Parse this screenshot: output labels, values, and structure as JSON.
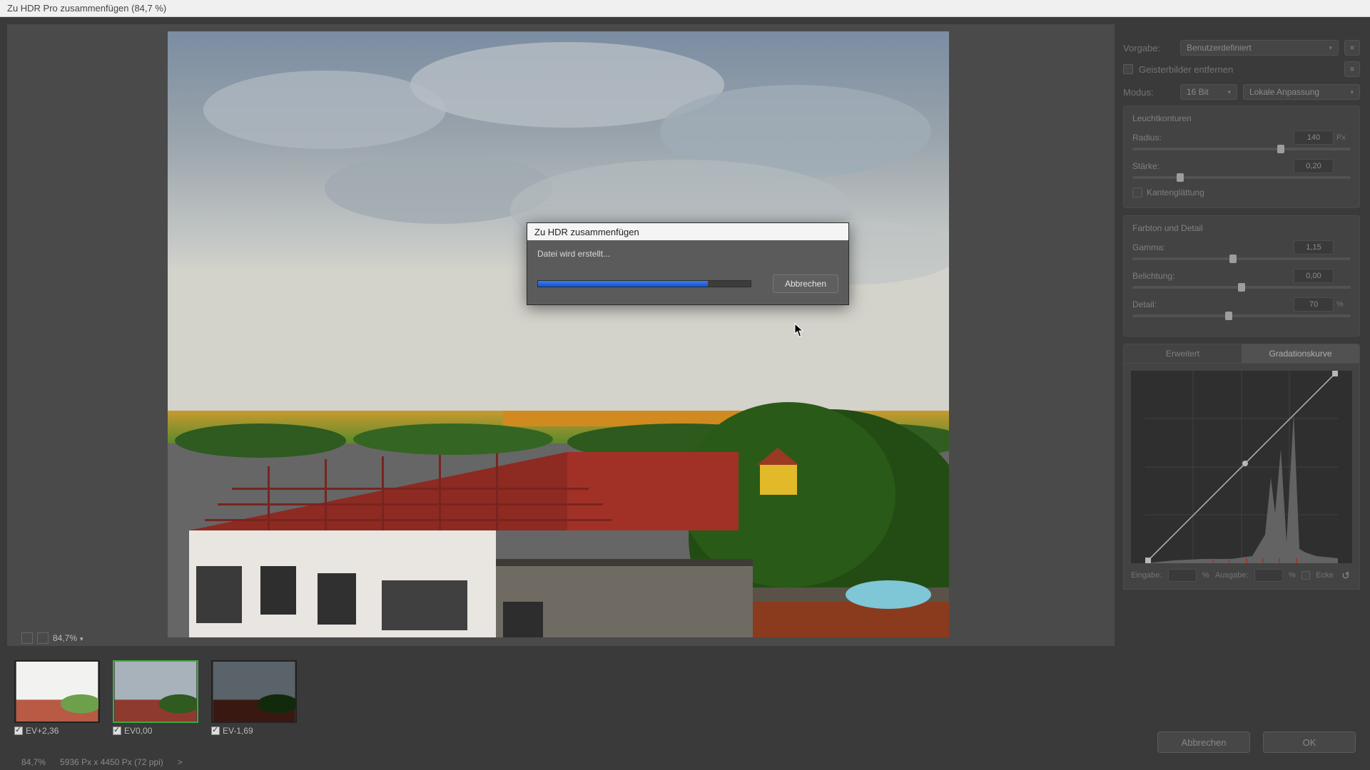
{
  "window": {
    "title": "Zu HDR Pro zusammenfügen (84,7 %)"
  },
  "zoom": {
    "value": "84,7%"
  },
  "thumbnails": [
    {
      "label": "EV+2,36",
      "checked": true,
      "selected": false
    },
    {
      "label": "EV0,00",
      "checked": true,
      "selected": true
    },
    {
      "label": "EV-1,69",
      "checked": true,
      "selected": false
    }
  ],
  "status": {
    "zoom": "84,7%",
    "dims": "5936 Px x 4450 Px (72 ppi)",
    "arrow": ">"
  },
  "side": {
    "preset_label": "Vorgabe:",
    "preset_value": "Benutzerdefiniert",
    "ghost_label": "Geisterbilder entfernen",
    "mode_label": "Modus:",
    "mode_value": "16 Bit",
    "local_value": "Lokale Anpassung",
    "sections": {
      "edgeglow": {
        "title": "Leuchtkonturen",
        "radius_label": "Radius:",
        "radius_value": "140",
        "radius_unit": "Px",
        "strength_label": "Stärke:",
        "strength_value": "0,20",
        "edgesmooth_label": "Kantenglättung"
      },
      "tonedetail": {
        "title": "Farbton und Detail",
        "gamma_label": "Gamma:",
        "gamma_value": "1,15",
        "exposure_label": "Belichtung:",
        "exposure_value": "0,00",
        "detail_label": "Detail:",
        "detail_value": "70",
        "detail_unit": "%"
      }
    },
    "tabs": {
      "advanced": "Erweitert",
      "curve": "Gradationskurve"
    },
    "curve_io": {
      "input_label": "Eingabe:",
      "output_label": "Ausgabe:",
      "pct": "%",
      "corner_label": "Ecke"
    }
  },
  "footer": {
    "cancel": "Abbrechen",
    "ok": "OK"
  },
  "dialog": {
    "title": "Zu HDR zusammenfügen",
    "message": "Datei wird erstellt...",
    "progress_pct": 80,
    "cancel": "Abbrechen"
  }
}
